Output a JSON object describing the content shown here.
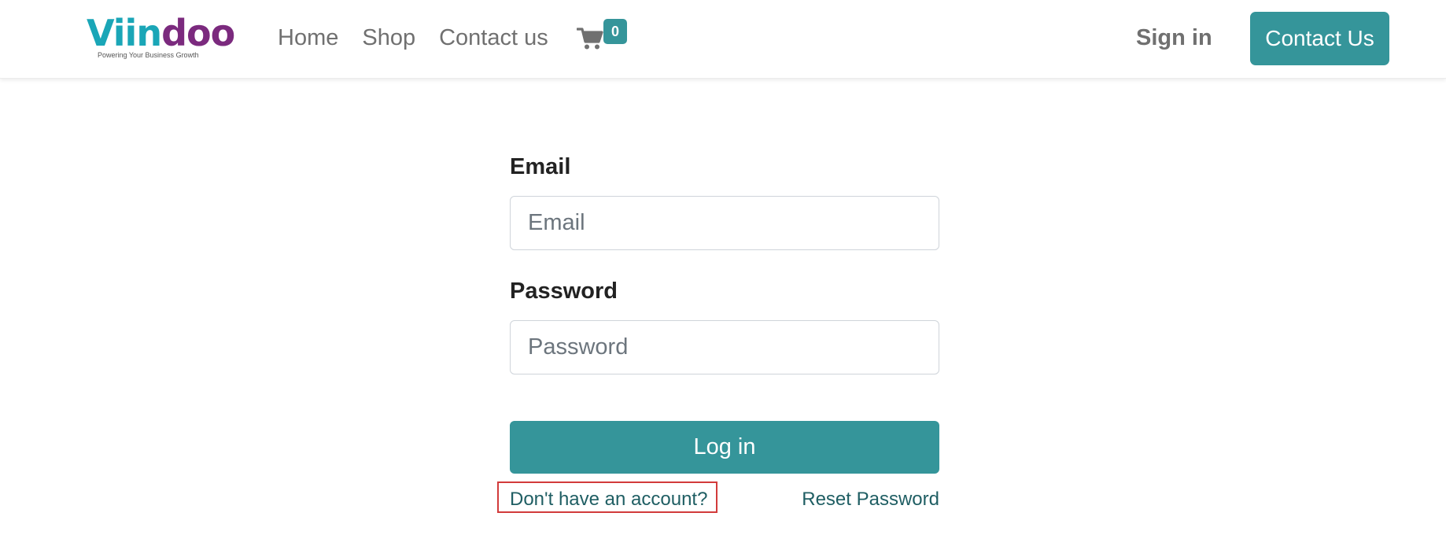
{
  "brand": {
    "logo_part_a": "Viin",
    "logo_part_b": "doo",
    "tagline": "Powering Your Business Growth",
    "primary_color": "#35959a",
    "logo_color_a": "#1aa6b7",
    "logo_color_b": "#7b2a7e"
  },
  "nav": {
    "items": [
      {
        "label": "Home"
      },
      {
        "label": "Shop"
      },
      {
        "label": "Contact us"
      }
    ]
  },
  "cart": {
    "icon": "shopping-cart-icon",
    "count": "0"
  },
  "header_actions": {
    "sign_in_label": "Sign in",
    "contact_button_label": "Contact Us"
  },
  "login_form": {
    "email_label": "Email",
    "email_placeholder": "Email",
    "email_value": "",
    "password_label": "Password",
    "password_placeholder": "Password",
    "password_value": "",
    "submit_label": "Log in",
    "signup_link_label": "Don't have an account?",
    "reset_link_label": "Reset Password",
    "highlight_color": "#d23b3b"
  }
}
